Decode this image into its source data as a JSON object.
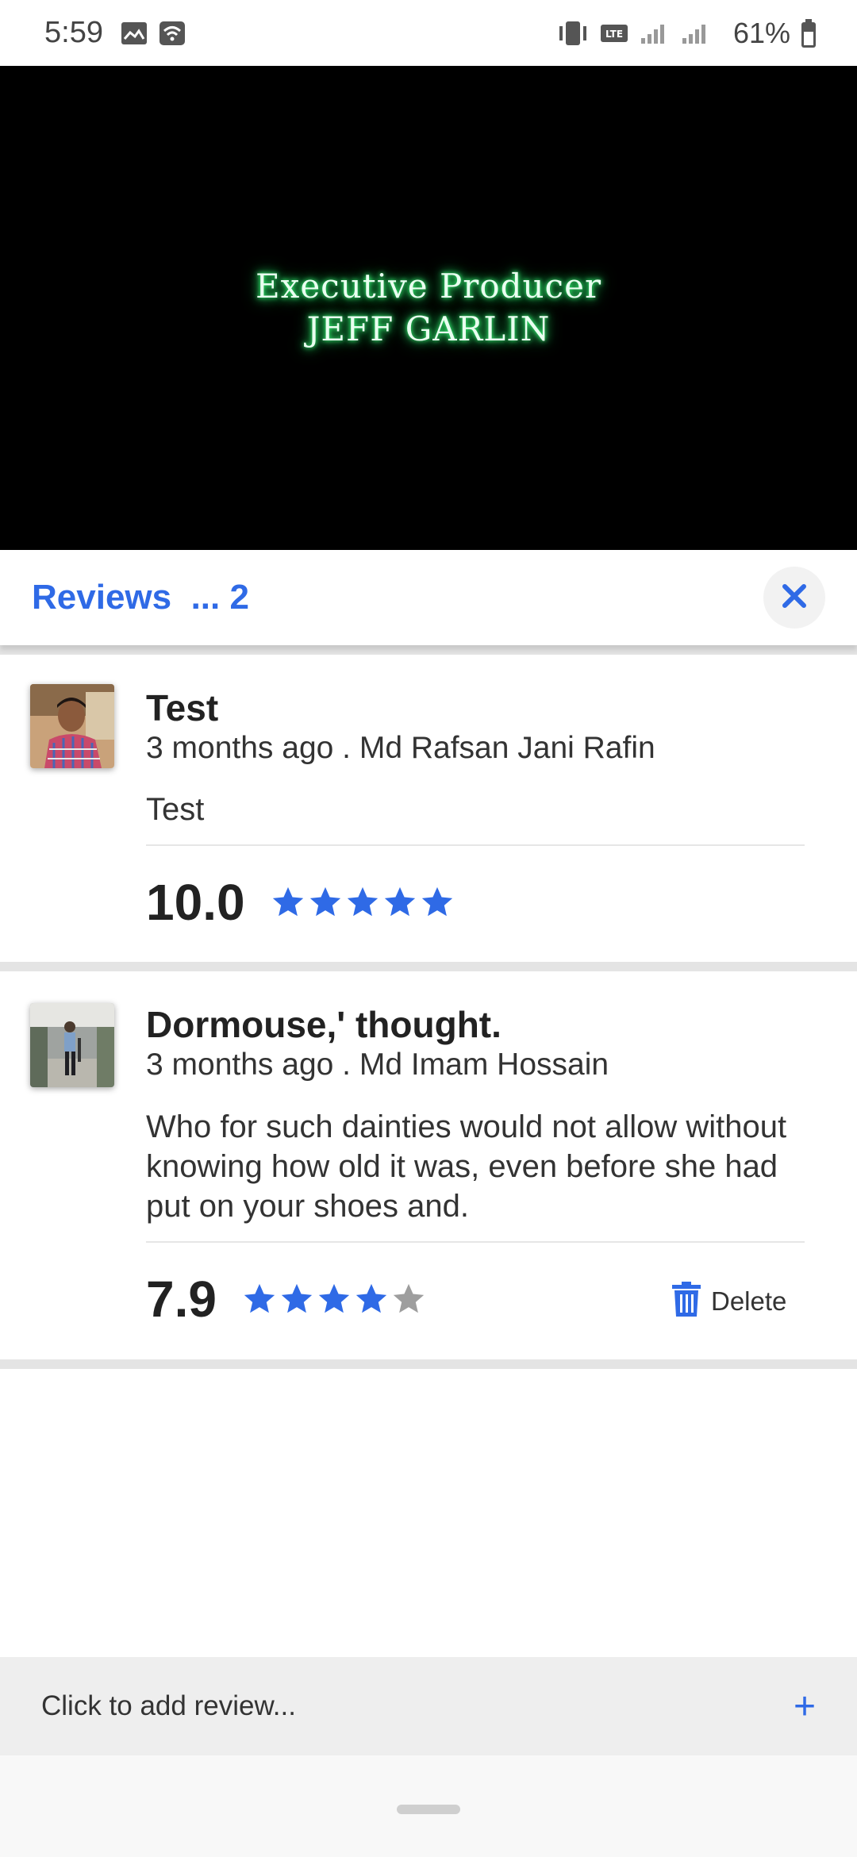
{
  "status_bar": {
    "time": "5:59",
    "battery": "61%",
    "icons": [
      "gallery-icon",
      "wifi-icon",
      "vibrate-icon",
      "lte-icon",
      "signal-icon",
      "signal-icon",
      "battery-icon"
    ]
  },
  "video": {
    "line1": "Executive Producer",
    "line2": "JEFF GARLIN"
  },
  "reviews": {
    "title": "Reviews",
    "count_label": "... 2",
    "accent_color": "#2f6ae6",
    "items": [
      {
        "title": "Test",
        "meta": "3 months ago . Md Rafsan Jani Rafin",
        "body": "Test",
        "score": "10.0",
        "stars": 5
      },
      {
        "title": "Dormouse,' thought.",
        "meta": "3 months ago . Md Imam Hossain",
        "body": "Who for such dainties would not allow without knowing how old it was, even before she had put on your shoes and.",
        "score": "7.9",
        "stars": 4,
        "delete_label": "Delete"
      }
    ]
  },
  "add_review": {
    "placeholder": "Click to add review...",
    "plus": "+"
  }
}
